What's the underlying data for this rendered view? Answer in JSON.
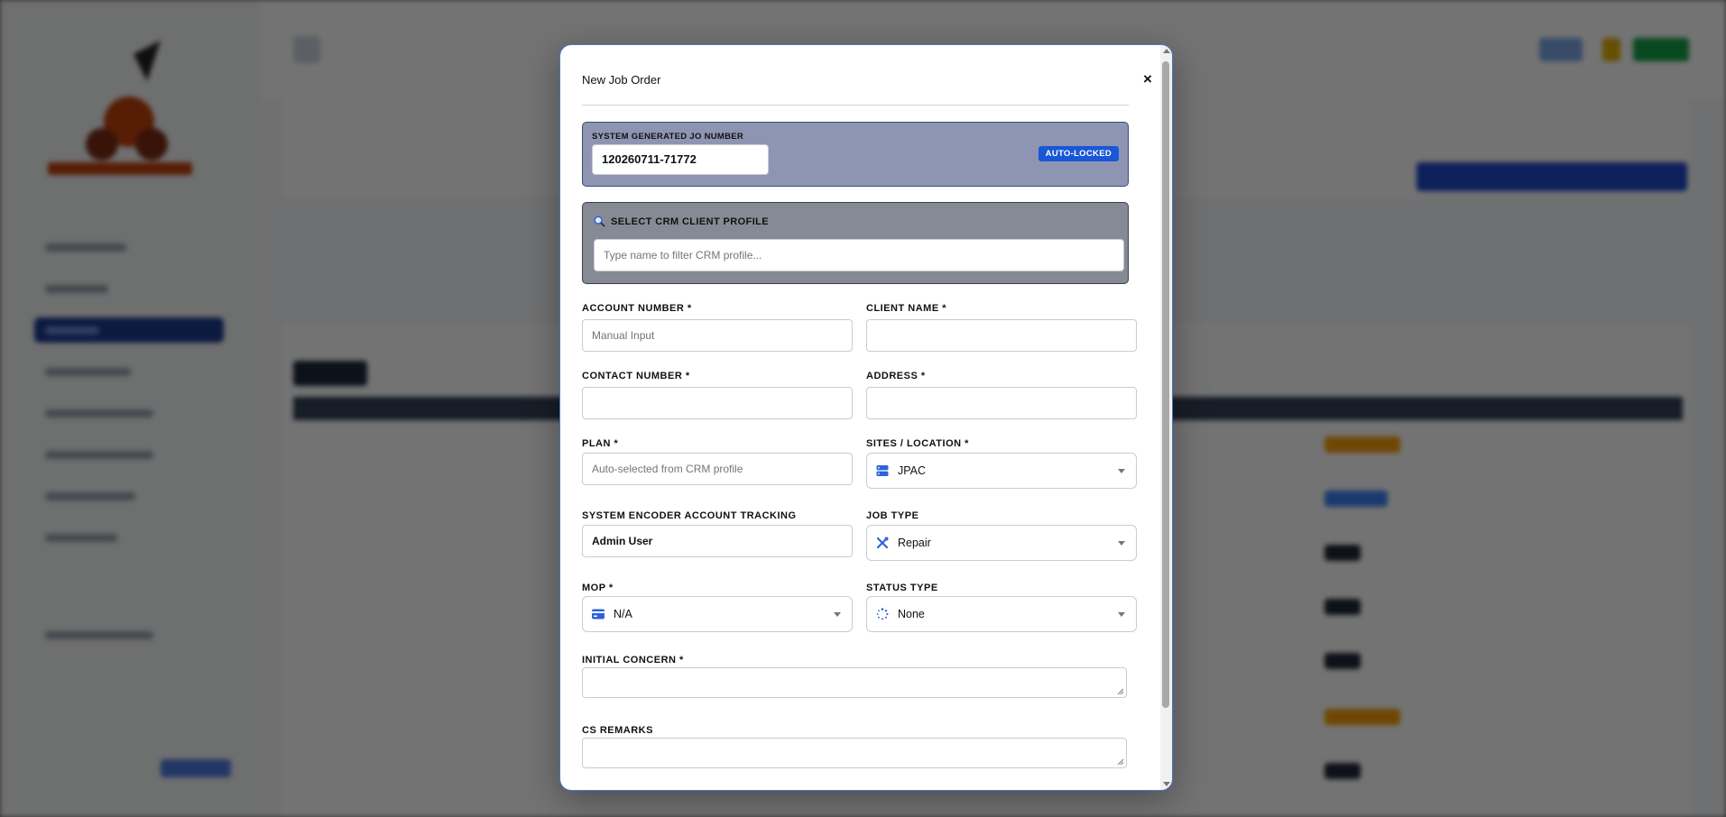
{
  "modal": {
    "title": "New Job Order",
    "close_label": "×"
  },
  "jo_number": {
    "label": "SYSTEM GENERATED JO NUMBER",
    "value": "120260711-71772",
    "badge": "AUTO-LOCKED"
  },
  "crm": {
    "label": "SELECT CRM CLIENT PROFILE",
    "placeholder": "Type name to filter CRM profile..."
  },
  "fields": {
    "account_number": {
      "label": "ACCOUNT NUMBER *",
      "placeholder": "Manual Input"
    },
    "client_name": {
      "label": "CLIENT NAME *",
      "value": ""
    },
    "contact_number": {
      "label": "CONTACT NUMBER *",
      "value": ""
    },
    "address": {
      "label": "ADDRESS *",
      "value": ""
    },
    "plan": {
      "label": "PLAN *",
      "placeholder": "Auto-selected from CRM profile"
    },
    "sites": {
      "label": "SITES / LOCATION *",
      "value": "JPAC"
    },
    "encoder": {
      "label": "SYSTEM ENCODER ACCOUNT TRACKING",
      "value": "Admin User"
    },
    "job_type": {
      "label": "JOB TYPE",
      "value": "Repair"
    },
    "mop": {
      "label": "MOP *",
      "value": "N/A"
    },
    "status_type": {
      "label": "STATUS TYPE",
      "value": "None"
    },
    "initial_concern": {
      "label": "INITIAL CONCERN *"
    },
    "cs_remarks": {
      "label": "CS REMARKS"
    }
  },
  "colors": {
    "accent": "#1a56d6",
    "jo_box": "#8e95b3",
    "crm_box": "#868a94",
    "icon_blue": "#2f63d8"
  }
}
